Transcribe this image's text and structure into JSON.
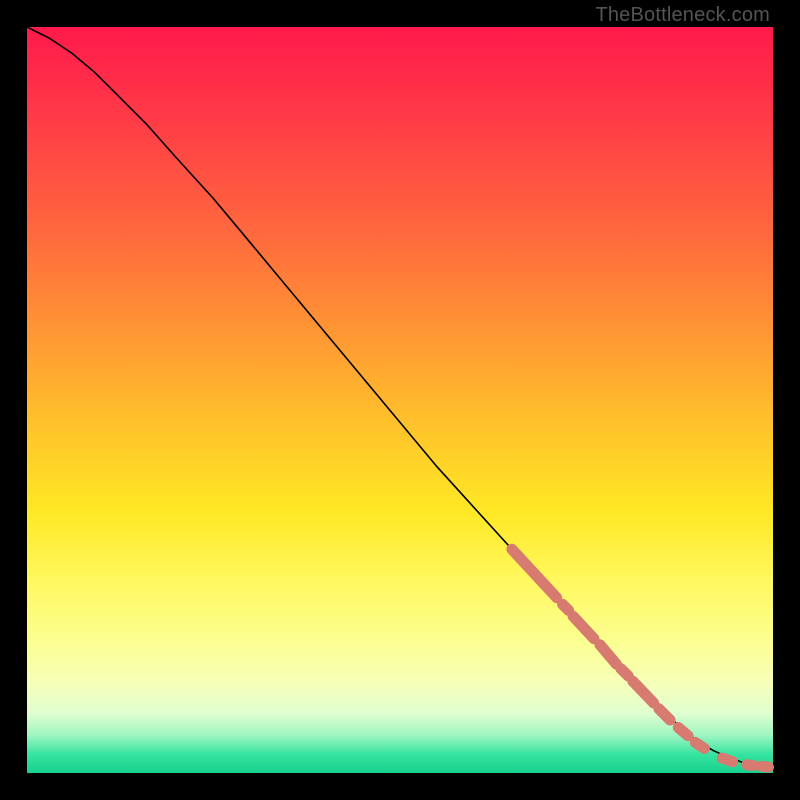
{
  "watermark": "TheBottleneck.com",
  "colors": {
    "marker": "#d77a70",
    "line": "#000000",
    "frame": "#000000"
  },
  "chart_data": {
    "type": "line",
    "title": "",
    "xlabel": "",
    "ylabel": "",
    "xlim": [
      0,
      100
    ],
    "ylim": [
      0,
      100
    ],
    "series": [
      {
        "name": "curve",
        "x": [
          0,
          3,
          6,
          9,
          12,
          16,
          20,
          25,
          30,
          35,
          40,
          45,
          50,
          55,
          60,
          65,
          70,
          75,
          80,
          85,
          88,
          90,
          92,
          94,
          96,
          98,
          100
        ],
        "y": [
          100,
          98.5,
          96.5,
          94,
          91,
          87,
          82.5,
          77,
          71,
          65,
          59,
          53,
          47,
          41,
          35.5,
          30,
          24.5,
          19,
          13.5,
          8.5,
          5.8,
          4.2,
          3.0,
          2.1,
          1.4,
          1.0,
          0.8
        ]
      }
    ],
    "markers": {
      "name": "highlighted-segments",
      "style": "thick-rounded",
      "color": "#d77a70",
      "segments": [
        {
          "x0": 65.0,
          "y0": 30.0,
          "x1": 71.0,
          "y1": 23.5
        },
        {
          "x0": 71.8,
          "y0": 22.6,
          "x1": 72.6,
          "y1": 21.8
        },
        {
          "x0": 73.2,
          "y0": 21.0,
          "x1": 76.0,
          "y1": 18.0
        },
        {
          "x0": 76.8,
          "y0": 17.2,
          "x1": 79.0,
          "y1": 14.6
        },
        {
          "x0": 79.6,
          "y0": 14.0,
          "x1": 80.6,
          "y1": 13.0
        },
        {
          "x0": 81.2,
          "y0": 12.3,
          "x1": 84.0,
          "y1": 9.4
        },
        {
          "x0": 84.7,
          "y0": 8.6,
          "x1": 86.2,
          "y1": 7.1
        },
        {
          "x0": 87.3,
          "y0": 6.1,
          "x1": 88.6,
          "y1": 5.0
        },
        {
          "x0": 89.6,
          "y0": 4.1,
          "x1": 90.8,
          "y1": 3.3
        },
        {
          "x0": 93.2,
          "y0": 2.0,
          "x1": 94.6,
          "y1": 1.5
        },
        {
          "x0": 96.5,
          "y0": 1.1,
          "x1": 97.3,
          "y1": 1.0
        },
        {
          "x0": 98.4,
          "y0": 0.9,
          "x1": 99.4,
          "y1": 0.8
        }
      ]
    }
  }
}
